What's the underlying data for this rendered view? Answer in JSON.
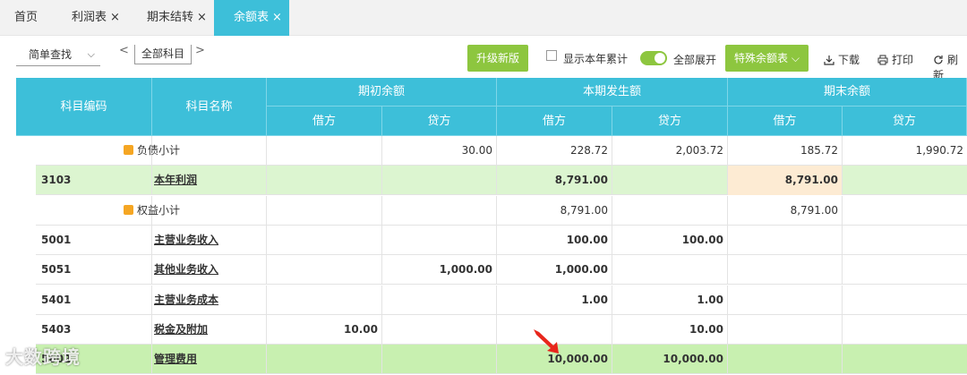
{
  "tabs": [
    {
      "label": "首页",
      "closable": false,
      "active": false
    },
    {
      "label": "利润表",
      "closable": true,
      "active": false
    },
    {
      "label": "期末结转",
      "closable": true,
      "active": false
    },
    {
      "label": "余额表",
      "closable": true,
      "active": true
    }
  ],
  "close_glyph": "×",
  "toolbar": {
    "search_mode": "简单查找",
    "prev": "<",
    "next": ">",
    "subject": "全部科目",
    "upgrade_label": "升级新版",
    "show_year_label": "显示本年累计",
    "expand_label": "全部展开",
    "special_label": "特殊余额表",
    "download_label": "下载",
    "print_label": "打印",
    "refresh_label": "刷新"
  },
  "table": {
    "headers": {
      "code": "科目编码",
      "name": "科目名称",
      "opening": "期初余额",
      "period": "本期发生额",
      "closing": "期末余额",
      "debit": "借方",
      "credit": "贷方"
    },
    "rows": [
      {
        "code": "",
        "name": "负债小计",
        "subtotal": true,
        "bg": "#ffffff",
        "values": [
          "",
          "30.00",
          "228.72",
          "2,003.72",
          "185.72",
          "1,990.72"
        ]
      },
      {
        "code": "3103",
        "name": "本年利润",
        "subtotal": false,
        "bg": "#dcf5d0",
        "values": [
          "",
          "",
          "8,791.00",
          "",
          "8,791.00",
          ""
        ],
        "highlight_col": 4
      },
      {
        "code": "",
        "name": "权益小计",
        "subtotal": true,
        "bg": "#ffffff",
        "values": [
          "",
          "",
          "8,791.00",
          "",
          "8,791.00",
          ""
        ]
      },
      {
        "code": "5001",
        "name": "主营业务收入",
        "subtotal": false,
        "bg": "#ffffff",
        "values": [
          "",
          "",
          "100.00",
          "100.00",
          "",
          ""
        ]
      },
      {
        "code": "5051",
        "name": "其他业务收入",
        "subtotal": false,
        "bg": "#ffffff",
        "values": [
          "",
          "1,000.00",
          "1,000.00",
          "",
          "",
          ""
        ]
      },
      {
        "code": "5401",
        "name": "主营业务成本",
        "subtotal": false,
        "bg": "#ffffff",
        "values": [
          "",
          "",
          "1.00",
          "1.00",
          "",
          ""
        ]
      },
      {
        "code": "5403",
        "name": "税金及附加",
        "subtotal": false,
        "bg": "#ffffff",
        "values": [
          "10.00",
          "",
          "",
          "10.00",
          "",
          ""
        ]
      },
      {
        "code": "5602",
        "name": "管理费用",
        "subtotal": false,
        "bg": "#c8f0b0",
        "values": [
          "",
          "",
          "10,000.00",
          "10,000.00",
          "",
          ""
        ]
      }
    ]
  },
  "watermark": "大数跨境",
  "colors": {
    "accent": "#3dbfd9",
    "green": "#8dc63f",
    "highlight": "#fdebd3"
  }
}
